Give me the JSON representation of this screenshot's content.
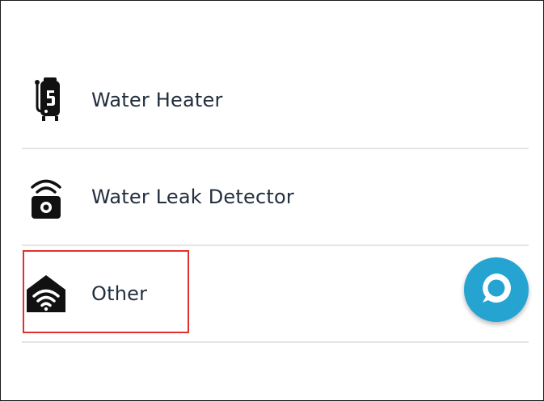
{
  "devices": [
    {
      "label": "Water Heater",
      "icon": "water-heater-icon"
    },
    {
      "label": "Water Leak Detector",
      "icon": "water-leak-detector-icon"
    },
    {
      "label": "Other",
      "icon": "smart-home-wifi-icon"
    }
  ],
  "highlighted_item": "Other",
  "colors": {
    "text": "#232f3e",
    "divider": "#e3e6e6",
    "highlight": "#e0312f",
    "alexa_blue": "#25a4d2"
  },
  "floating_button": {
    "icon": "alexa-icon"
  }
}
